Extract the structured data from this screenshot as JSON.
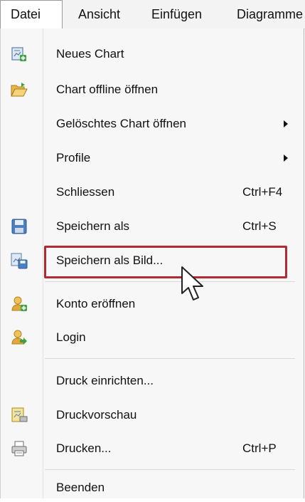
{
  "menubar": {
    "items": [
      {
        "label": "Datei",
        "active": true
      },
      {
        "label": "Ansicht",
        "active": false
      },
      {
        "label": "Einfügen",
        "active": false
      },
      {
        "label": "Diagramme",
        "active": false
      }
    ]
  },
  "menu": {
    "items": [
      {
        "label": "Neues Chart",
        "icon": "new-chart-icon",
        "shortcut": "",
        "submenu": false
      },
      {
        "label": "Chart offline öffnen",
        "icon": "folder-open-icon",
        "shortcut": "",
        "submenu": false
      },
      {
        "label": "Gelöschtes Chart öffnen",
        "icon": "",
        "shortcut": "",
        "submenu": true
      },
      {
        "label": "Profile",
        "icon": "",
        "shortcut": "",
        "submenu": true
      },
      {
        "label": "Schliessen",
        "icon": "",
        "shortcut": "Ctrl+F4",
        "submenu": false
      },
      {
        "label": "Speichern als",
        "icon": "save-icon",
        "shortcut": "Ctrl+S",
        "submenu": false
      },
      {
        "label": "Speichern als Bild...",
        "icon": "save-image-icon",
        "shortcut": "",
        "submenu": false
      },
      {
        "label": "Konto eröffnen",
        "icon": "user-add-icon",
        "shortcut": "",
        "submenu": false,
        "highlighted": true
      },
      {
        "label": "Login",
        "icon": "user-login-icon",
        "shortcut": "",
        "submenu": false
      },
      {
        "label": "Druck einrichten...",
        "icon": "",
        "shortcut": "",
        "submenu": false
      },
      {
        "label": "Druckvorschau",
        "icon": "print-preview-icon",
        "shortcut": "",
        "submenu": false
      },
      {
        "label": "Drucken...",
        "icon": "printer-icon",
        "shortcut": "Ctrl+P",
        "submenu": false
      },
      {
        "label": "Beenden",
        "icon": "",
        "shortcut": "",
        "submenu": false
      }
    ]
  },
  "colors": {
    "highlight_border": "#b32b31",
    "menubar_bg": "#f3f3f3",
    "menu_bg": "#f7f7f7"
  }
}
